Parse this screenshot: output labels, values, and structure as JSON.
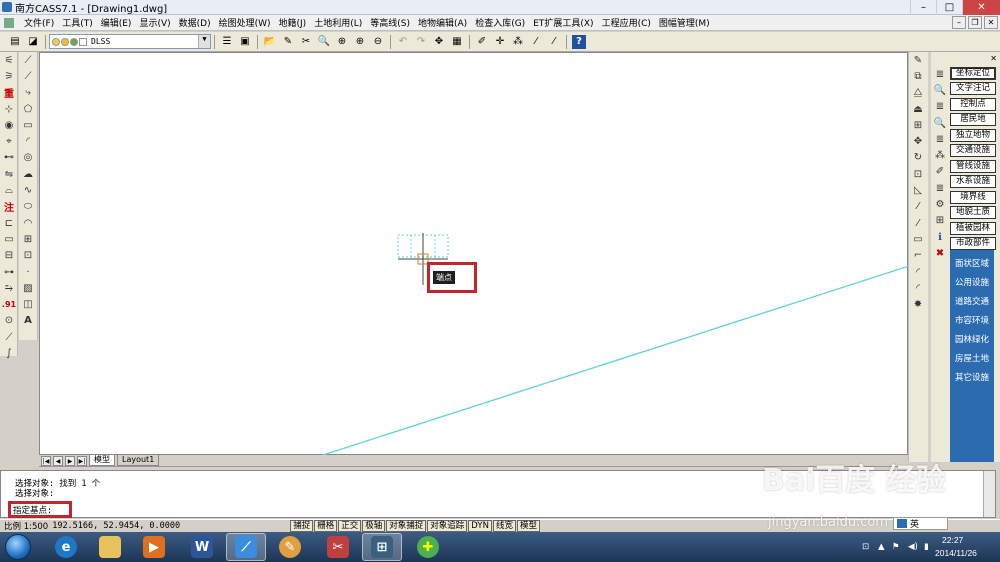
{
  "window": {
    "title": "南方CASS7.1 - [Drawing1.dwg]",
    "buttons": [
      "–",
      "□",
      "✕"
    ],
    "mdi_buttons": [
      "–",
      "❐",
      "✕"
    ]
  },
  "menu": [
    "文件(F)",
    "工具(T)",
    "编辑(E)",
    "显示(V)",
    "数据(D)",
    "绘图处理(W)",
    "地籍(J)",
    "土地利用(L)",
    "等高线(S)",
    "地物编辑(A)",
    "检查入库(G)",
    "ET扩展工具(X)",
    "工程应用(C)",
    "图幅管理(M)"
  ],
  "toolbar": {
    "layer_name": "DLSS",
    "layer_swatch_colors": [
      "#e8d04a",
      "#f0c030",
      "#6aa84f",
      "#ffffff"
    ]
  },
  "drawing_tooltip": "端点",
  "layout_tabs": [
    "模型",
    "Layout1"
  ],
  "right_panel": {
    "buttons": [
      "坐标定位",
      "文字注记",
      "控制点",
      "居民地",
      "独立地物",
      "交通设施",
      "管线设施",
      "水系设施",
      "境界线",
      "地貌土质",
      "植被园林",
      "市政部件"
    ],
    "blue_items": [
      "面状区域",
      "公用设施",
      "道路交通",
      "市容环境",
      "园林绿化",
      "房屋土地",
      "其它设施"
    ]
  },
  "command": {
    "history": [
      "选择对象: 找到 1 个",
      "选择对象:"
    ],
    "prompt": "指定基点:"
  },
  "status": {
    "scale": "比例 1:500",
    "coords": "192.5166, 52.9454, 0.0000",
    "toggles": [
      "捕捉",
      "栅格",
      "正交",
      "极轴",
      "对象捕捉",
      "对象追踪",
      "DYN",
      "线宽",
      "模型"
    ]
  },
  "taskbar": {
    "time": "22:27",
    "date": "2014/11/26",
    "ime_label": "英"
  },
  "watermark": {
    "text": "Bai百度 经验",
    "url": "jingyan.baidu.com"
  },
  "colors": {
    "highlight_box": "#c0272d",
    "cad_line": "#5fd0d8",
    "blue_panel": "#2b6cb0"
  }
}
